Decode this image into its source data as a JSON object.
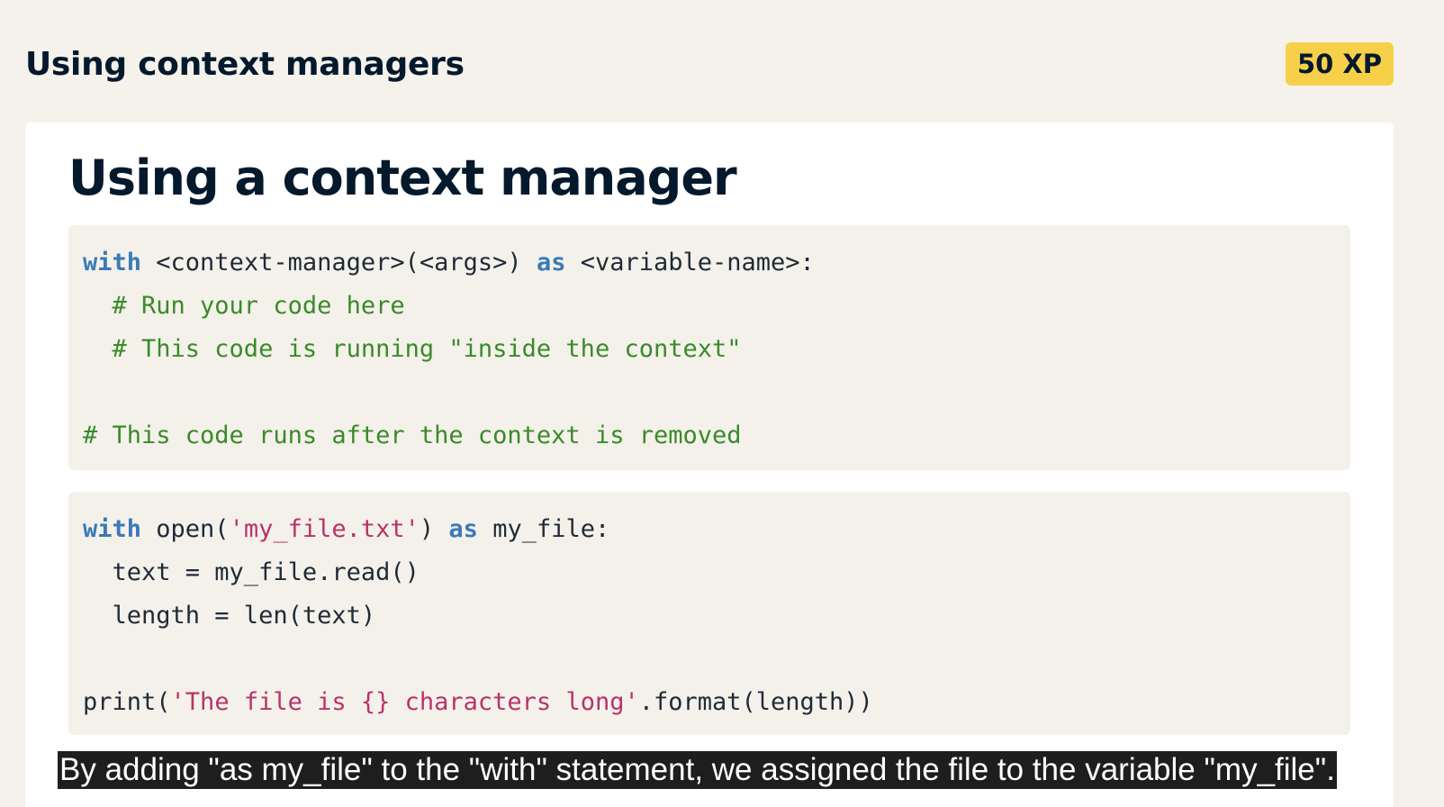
{
  "header": {
    "exercise_title": "Using context managers",
    "xp_badge": "50 XP"
  },
  "slide": {
    "title": "Using a context manager",
    "code_block_1": {
      "line_1": {
        "kw1": "with",
        "text1": " <context-manager>(<args>) ",
        "kw2": "as",
        "text2": " <variable-name>:"
      },
      "line_2": "  # Run your code here",
      "line_3": "  # This code is running \"inside the context\"",
      "line_4": "",
      "line_5": "# This code runs after the context is removed"
    },
    "code_block_2": {
      "line_1": {
        "kw1": "with",
        "text1": " open(",
        "str1": "'my_file.txt'",
        "text2": ") ",
        "kw2": "as",
        "text3": " my_file:"
      },
      "line_2": "  text = my_file.read()",
      "line_3": "  length = len(text)",
      "line_4": "",
      "line_5": {
        "text1": "print(",
        "str1": "'The file is {} characters long'",
        "text2": ".format(length))"
      }
    }
  },
  "caption": "By adding \"as my_file\" to the \"with\" statement, we assigned the file to the variable \"my_file\".",
  "colors": {
    "background": "#f5f2ec",
    "xp_badge": "#f7d04a",
    "keyword": "#3a7ab8",
    "comment": "#3a8a2a",
    "string": "#b8336a"
  }
}
